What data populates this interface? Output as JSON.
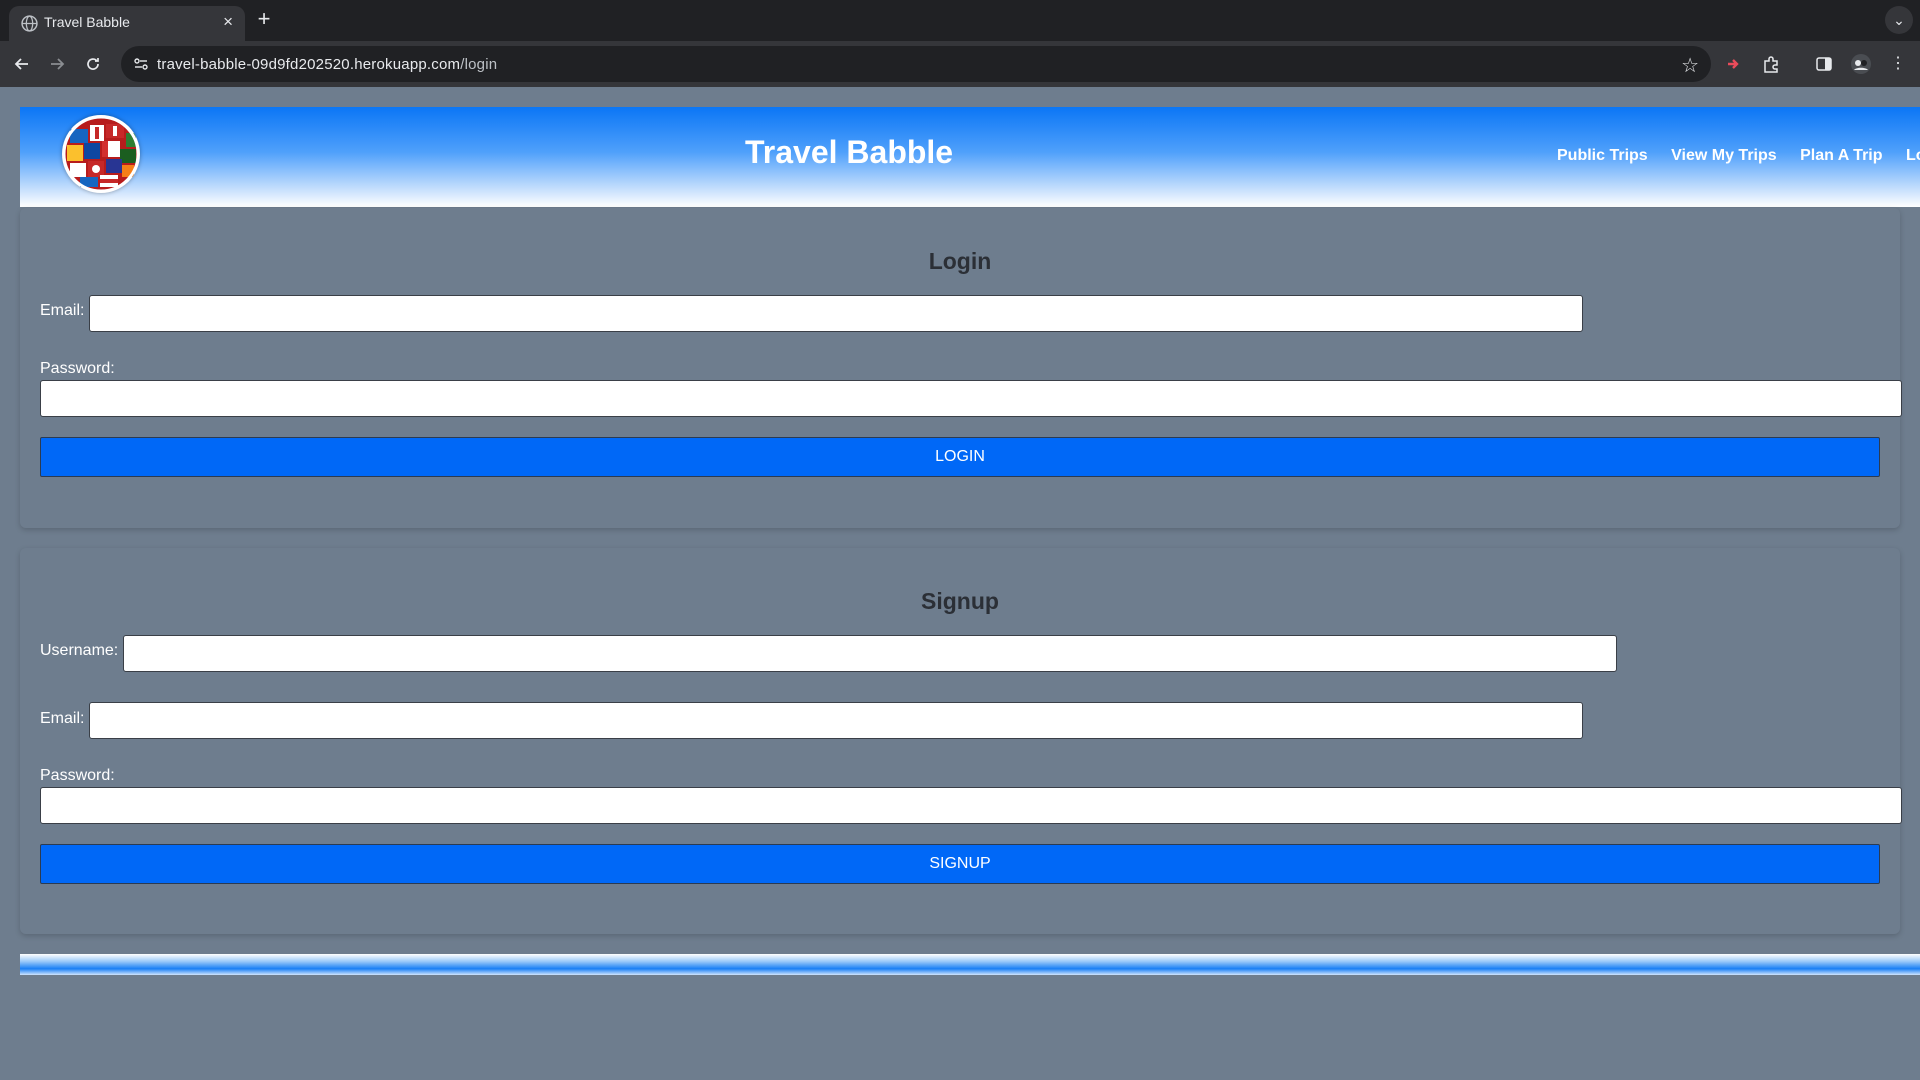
{
  "browser": {
    "tab_title": "Travel Babble",
    "tab_close": "×",
    "new_tab": "+",
    "tab_menu": "⌄",
    "url_host": "travel-babble-09d9fd202520.herokuapp.com",
    "url_path": "/login",
    "icons": [
      "back-icon",
      "forward-icon",
      "reload-icon",
      "site-info-icon",
      "star-icon",
      "extension-icon",
      "puzzle-icon",
      "sidebar-icon",
      "profile-icon",
      "menu-icon"
    ]
  },
  "header": {
    "title": "Travel Babble",
    "nav": [
      "Public Trips",
      "View My Trips",
      "Plan A Trip",
      "Log"
    ]
  },
  "login": {
    "heading": "Login",
    "email_label": "Email:",
    "email_value": "",
    "password_label": "Password:",
    "password_value": "",
    "button": "LOGIN"
  },
  "signup": {
    "heading": "Signup",
    "username_label": "Username:",
    "username_value": "",
    "email_label": "Email:",
    "email_value": "",
    "password_label": "Password:",
    "password_value": "",
    "button": "SIGNUP"
  },
  "colors": {
    "page_background": "#6e7d8e",
    "header_blue": "#0b76f5",
    "button_blue": "#0068f7",
    "heading_text": "#2b2f36"
  }
}
